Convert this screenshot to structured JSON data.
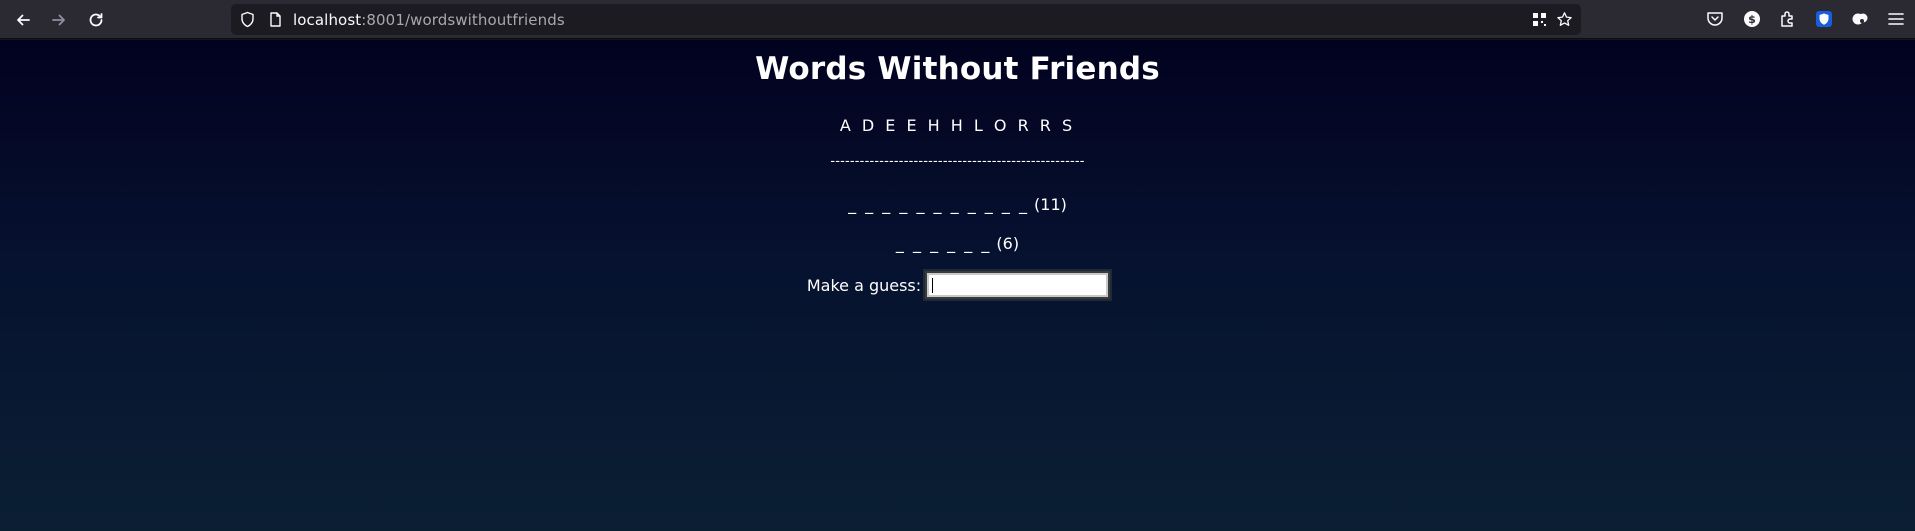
{
  "browser": {
    "url_host": "localhost",
    "url_rest": ":8001/wordswithoutfriends"
  },
  "game": {
    "title": "Words Without Friends",
    "letters": "A D E E H H L O R R S",
    "divider": "----------------------------------------------------",
    "slots": [
      {
        "blanks": "_ _ _ _ _ _ _ _ _ _ _",
        "count_label": "(11)"
      },
      {
        "blanks": "_ _ _ _ _ _",
        "count_label": "(6)"
      }
    ],
    "guess_label": "Make a guess:",
    "guess_value": ""
  },
  "colors": {
    "background_top": "#02021f",
    "background_bottom": "#0b1f33",
    "text": "#ffffff"
  }
}
